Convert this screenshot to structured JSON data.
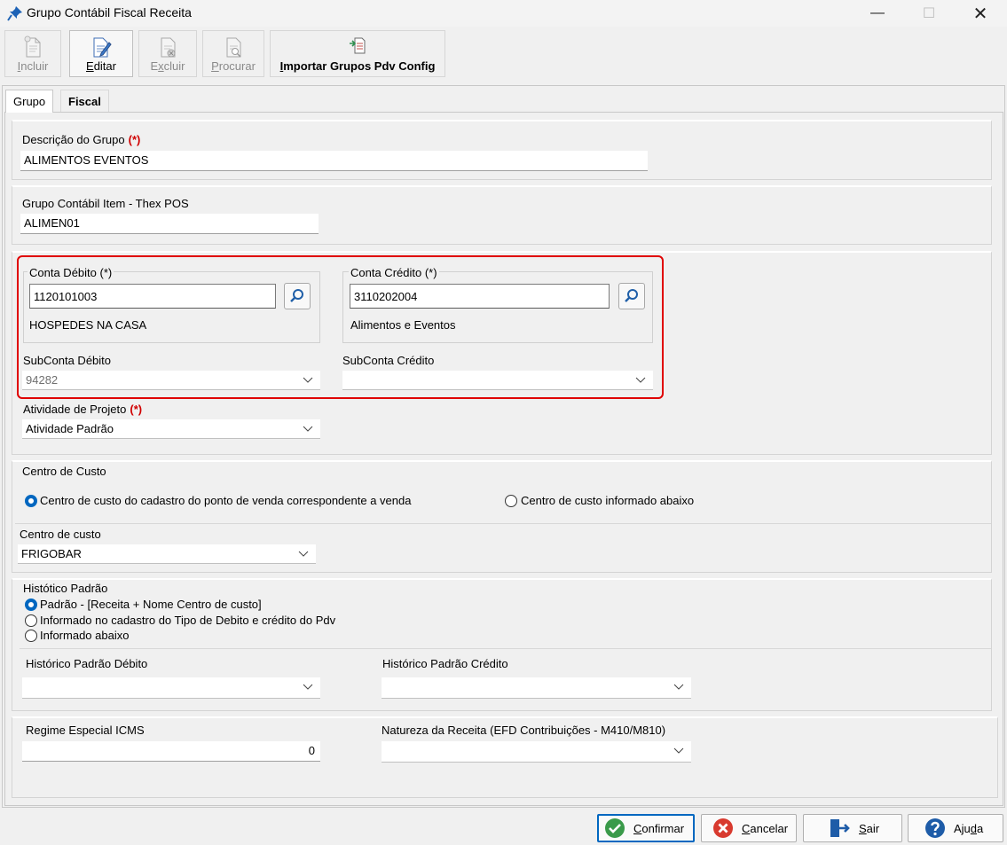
{
  "window": {
    "title": "Grupo Contábil Fiscal Receita",
    "minimize": "—",
    "maximize": "☐",
    "close": "✕"
  },
  "toolbar": {
    "incluir": {
      "pre": "",
      "u": "I",
      "post": "ncluir"
    },
    "editar": {
      "pre": "",
      "u": "E",
      "post": "ditar"
    },
    "excluir": {
      "pre": "E",
      "u": "x",
      "post": "cluir"
    },
    "procurar": {
      "pre": "",
      "u": "P",
      "post": "rocurar"
    },
    "importar": {
      "pre": "",
      "u": "I",
      "post": "mportar Grupos Pdv Config"
    }
  },
  "tabs": {
    "grupo": "Grupo",
    "fiscal": "Fiscal"
  },
  "descricao": {
    "label": "Descrição do Grupo",
    "required": "(*)",
    "value": "ALIMENTOS EVENTOS"
  },
  "grupo_item": {
    "label": "Grupo Contábil Item - Thex POS",
    "value": "ALIMEN01"
  },
  "conta_debito": {
    "label": "Conta Débito (*)",
    "value": "1120101003",
    "description": "HOSPEDES NA CASA"
  },
  "conta_credito": {
    "label": "Conta Crédito (*)",
    "value": "3110202004",
    "description": "Alimentos e Eventos"
  },
  "subconta_debito": {
    "label": "SubConta Débito",
    "value": "94282"
  },
  "subconta_credito": {
    "label": "SubConta Crédito",
    "value": ""
  },
  "atividade": {
    "label": "Atividade de Projeto",
    "required": "(*)",
    "value": "Atividade Padrão"
  },
  "centro_custo_group": {
    "title": "Centro de Custo",
    "option1": "Centro de custo do cadastro do ponto de venda correspondente a venda",
    "option2": "Centro de custo informado abaixo",
    "selected": "option1"
  },
  "centro_custo": {
    "label": "Centro de custo",
    "value": "FRIGOBAR"
  },
  "historico": {
    "title": "Histótico Padrão",
    "option1": "Padrão - [Receita + Nome Centro de custo]",
    "option2": "Informado no cadastro do Tipo de Debito e crédito do Pdv",
    "option3": "Informado abaixo",
    "selected": "option1",
    "debito_label": "Histórico Padrão Débito",
    "debito_value": "",
    "credito_label": "Histórico Padrão Crédito",
    "credito_value": ""
  },
  "regime": {
    "label": "Regime Especial ICMS",
    "value": "0"
  },
  "natureza": {
    "label": "Natureza da Receita (EFD Contribuições - M410/M810)",
    "value": ""
  },
  "buttons": {
    "confirmar": {
      "pre": "",
      "u": "C",
      "post": "onfirmar"
    },
    "cancelar": {
      "pre": "",
      "u": "C",
      "post": "ancelar"
    },
    "sair": {
      "pre": "",
      "u": "S",
      "post": "air"
    },
    "ajuda": {
      "pre": "Aju",
      "u": "d",
      "post": "a"
    }
  },
  "colors": {
    "accent": "#0067c0",
    "required": "#d00000",
    "highlight": "#e00000",
    "confirm": "#3a9a4a",
    "cancel": "#d83a2f",
    "help": "#1e5ca8"
  }
}
